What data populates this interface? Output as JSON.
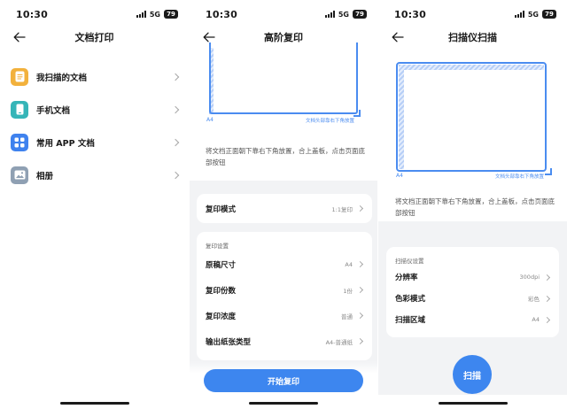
{
  "status_bar": {
    "time": "10:30",
    "network": "5G",
    "battery": "79"
  },
  "screens": {
    "documents": {
      "title": "文档打印",
      "items": [
        {
          "label": "我扫描的文档",
          "icon": "document-icon",
          "color": "#f2b13c"
        },
        {
          "label": "手机文档",
          "icon": "phone-icon",
          "color": "#35b5b8"
        },
        {
          "label": "常用 APP 文档",
          "icon": "apps-icon",
          "color": "#3f82ee"
        },
        {
          "label": "相册",
          "icon": "photo-icon",
          "color": "#8fa0b3"
        }
      ]
    },
    "copy": {
      "title": "高阶复印",
      "paper_label": "A4",
      "paper_tip": "文档头部靠右下角放置",
      "hint": "将文档正面朝下靠右下角放置，合上盖板，点击页面底部按钮",
      "mode": {
        "label": "复印模式",
        "value": "1:1复印"
      },
      "settings_title": "复印设置",
      "settings": [
        {
          "label": "原稿尺寸",
          "value": "A4"
        },
        {
          "label": "复印份数",
          "value": "1份"
        },
        {
          "label": "复印浓度",
          "value": "普通"
        },
        {
          "label": "输出纸张类型",
          "value": "A4-普通纸"
        }
      ],
      "action": "开始复印"
    },
    "scan": {
      "title": "扫描仪扫描",
      "paper_label": "A4",
      "paper_tip": "文档头部靠右下角放置",
      "hint": "将文档正面朝下靠右下角放置，合上盖板，点击页面底部按钮",
      "settings_title": "扫描仪设置",
      "settings": [
        {
          "label": "分辨率",
          "value": "300dpi"
        },
        {
          "label": "色彩模式",
          "value": "彩色"
        },
        {
          "label": "扫描区域",
          "value": "A4"
        }
      ],
      "action": "扫描"
    }
  },
  "colors": {
    "accent": "#3d86ef",
    "page_bg": "#f2f3f5"
  }
}
